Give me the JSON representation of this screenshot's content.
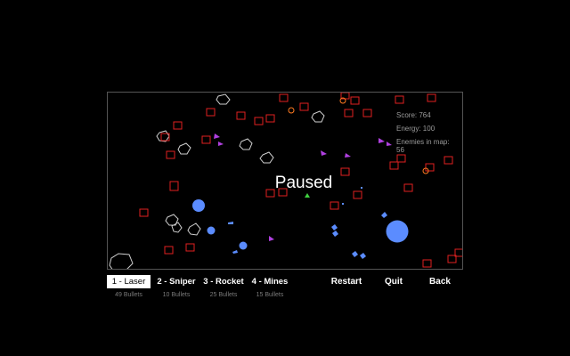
{
  "hud": {
    "score": "Score: 764",
    "energy": "Energy: 100",
    "enemies": "Enemies in map: 56"
  },
  "status": {
    "paused": "Paused"
  },
  "weapons": [
    {
      "label": "1 - Laser",
      "ammo": "49 Bullets",
      "selected": true
    },
    {
      "label": "2 - Sniper",
      "ammo": "10 Bullets",
      "selected": false
    },
    {
      "label": "3 - Rocket",
      "ammo": "25 Bullets",
      "selected": false
    },
    {
      "label": "4 - Mines",
      "ammo": "15 Bullets",
      "selected": false
    }
  ],
  "menu": {
    "restart": "Restart",
    "quit": "Quit",
    "back": "Back"
  },
  "colors": {
    "background": "#000000",
    "enemy_box": "#e02020",
    "asteroid": "#cfcfcf",
    "player_ally": "#5b8cff",
    "arrow_enemy": "#b040e0",
    "player_ship": "#40d040",
    "mine": "#ff7a20"
  }
}
